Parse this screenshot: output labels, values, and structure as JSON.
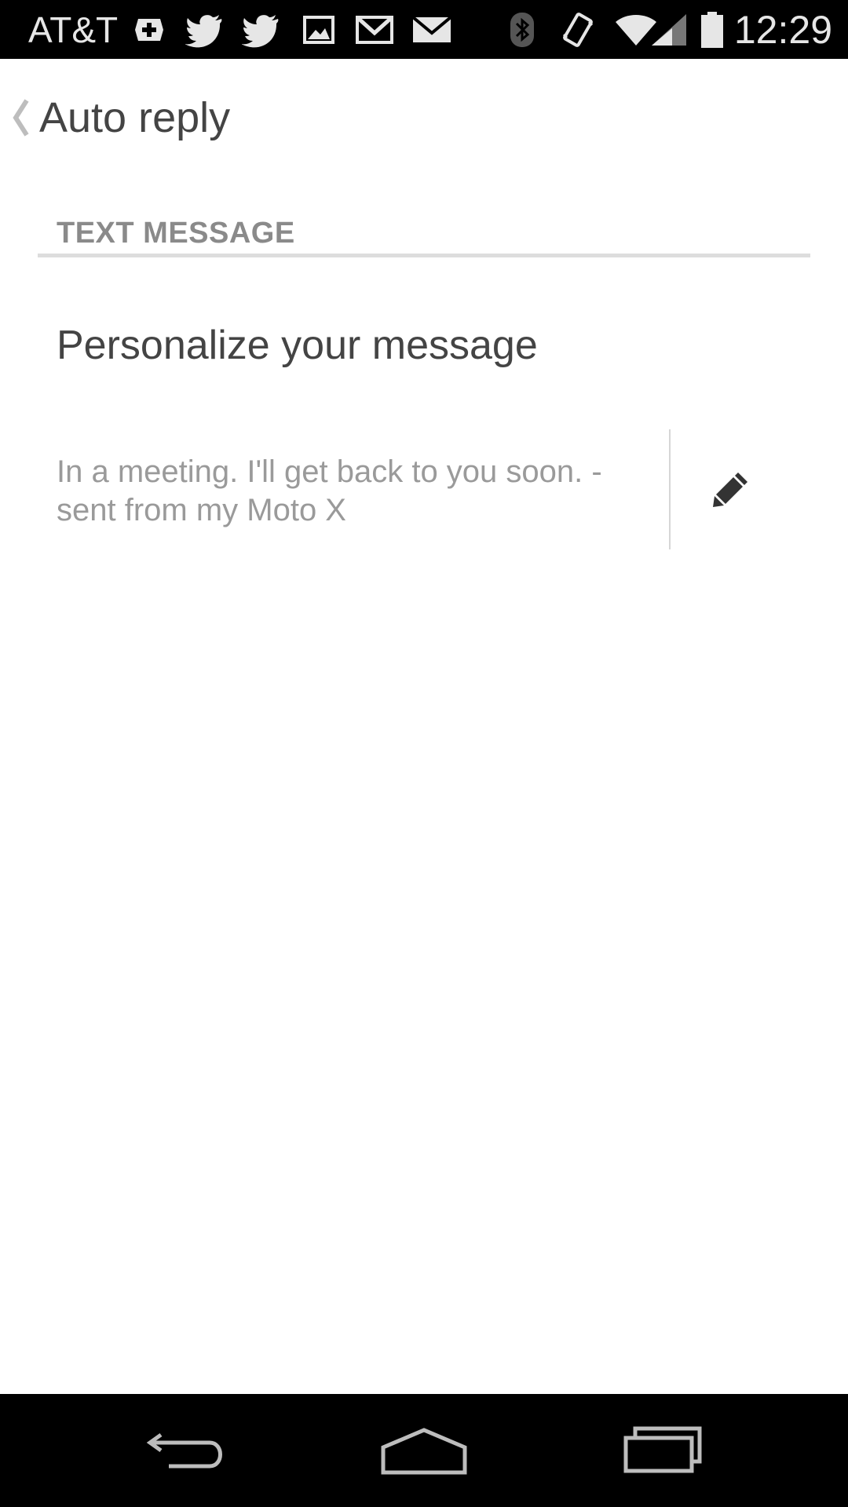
{
  "status_bar": {
    "carrier": "AT&T",
    "time": "12:29",
    "icons": [
      "health-plus-icon",
      "twitter-icon",
      "twitter-icon",
      "image-icon",
      "gmail-icon",
      "email-icon",
      "bluetooth-icon",
      "vibrate-icon",
      "wifi-icon",
      "signal-icon",
      "battery-icon"
    ]
  },
  "header": {
    "title": "Auto reply",
    "back_icon": "chevron-left-icon"
  },
  "section": {
    "label": "TEXT MESSAGE"
  },
  "preference": {
    "title": "Personalize your message",
    "summary": "In a meeting. I'll get back to you soon. - sent from my Moto X",
    "edit_icon": "pencil-icon"
  },
  "nav_bar": {
    "icons": [
      "back-icon",
      "home-icon",
      "recents-icon"
    ]
  }
}
